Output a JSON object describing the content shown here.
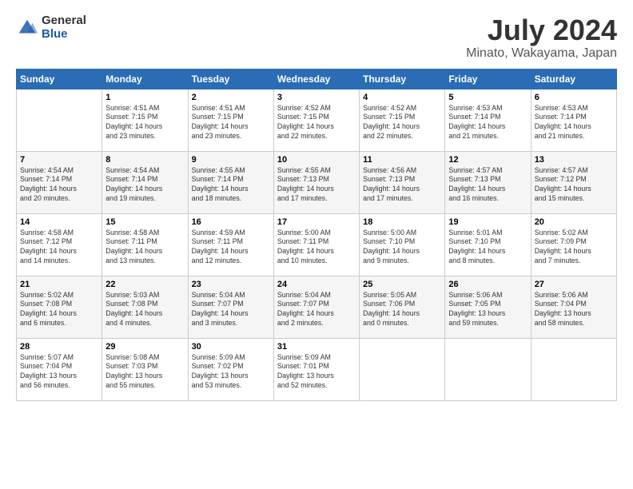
{
  "header": {
    "logo_general": "General",
    "logo_blue": "Blue",
    "month_title": "July 2024",
    "location": "Minato, Wakayama, Japan"
  },
  "days_of_week": [
    "Sunday",
    "Monday",
    "Tuesday",
    "Wednesday",
    "Thursday",
    "Friday",
    "Saturday"
  ],
  "weeks": [
    [
      {
        "day": "",
        "text": ""
      },
      {
        "day": "1",
        "text": "Sunrise: 4:51 AM\nSunset: 7:15 PM\nDaylight: 14 hours\nand 23 minutes."
      },
      {
        "day": "2",
        "text": "Sunrise: 4:51 AM\nSunset: 7:15 PM\nDaylight: 14 hours\nand 23 minutes."
      },
      {
        "day": "3",
        "text": "Sunrise: 4:52 AM\nSunset: 7:15 PM\nDaylight: 14 hours\nand 22 minutes."
      },
      {
        "day": "4",
        "text": "Sunrise: 4:52 AM\nSunset: 7:15 PM\nDaylight: 14 hours\nand 22 minutes."
      },
      {
        "day": "5",
        "text": "Sunrise: 4:53 AM\nSunset: 7:14 PM\nDaylight: 14 hours\nand 21 minutes."
      },
      {
        "day": "6",
        "text": "Sunrise: 4:53 AM\nSunset: 7:14 PM\nDaylight: 14 hours\nand 21 minutes."
      }
    ],
    [
      {
        "day": "7",
        "text": "Sunrise: 4:54 AM\nSunset: 7:14 PM\nDaylight: 14 hours\nand 20 minutes."
      },
      {
        "day": "8",
        "text": "Sunrise: 4:54 AM\nSunset: 7:14 PM\nDaylight: 14 hours\nand 19 minutes."
      },
      {
        "day": "9",
        "text": "Sunrise: 4:55 AM\nSunset: 7:14 PM\nDaylight: 14 hours\nand 18 minutes."
      },
      {
        "day": "10",
        "text": "Sunrise: 4:55 AM\nSunset: 7:13 PM\nDaylight: 14 hours\nand 17 minutes."
      },
      {
        "day": "11",
        "text": "Sunrise: 4:56 AM\nSunset: 7:13 PM\nDaylight: 14 hours\nand 17 minutes."
      },
      {
        "day": "12",
        "text": "Sunrise: 4:57 AM\nSunset: 7:13 PM\nDaylight: 14 hours\nand 16 minutes."
      },
      {
        "day": "13",
        "text": "Sunrise: 4:57 AM\nSunset: 7:12 PM\nDaylight: 14 hours\nand 15 minutes."
      }
    ],
    [
      {
        "day": "14",
        "text": "Sunrise: 4:58 AM\nSunset: 7:12 PM\nDaylight: 14 hours\nand 14 minutes."
      },
      {
        "day": "15",
        "text": "Sunrise: 4:58 AM\nSunset: 7:11 PM\nDaylight: 14 hours\nand 13 minutes."
      },
      {
        "day": "16",
        "text": "Sunrise: 4:59 AM\nSunset: 7:11 PM\nDaylight: 14 hours\nand 12 minutes."
      },
      {
        "day": "17",
        "text": "Sunrise: 5:00 AM\nSunset: 7:11 PM\nDaylight: 14 hours\nand 10 minutes."
      },
      {
        "day": "18",
        "text": "Sunrise: 5:00 AM\nSunset: 7:10 PM\nDaylight: 14 hours\nand 9 minutes."
      },
      {
        "day": "19",
        "text": "Sunrise: 5:01 AM\nSunset: 7:10 PM\nDaylight: 14 hours\nand 8 minutes."
      },
      {
        "day": "20",
        "text": "Sunrise: 5:02 AM\nSunset: 7:09 PM\nDaylight: 14 hours\nand 7 minutes."
      }
    ],
    [
      {
        "day": "21",
        "text": "Sunrise: 5:02 AM\nSunset: 7:08 PM\nDaylight: 14 hours\nand 6 minutes."
      },
      {
        "day": "22",
        "text": "Sunrise: 5:03 AM\nSunset: 7:08 PM\nDaylight: 14 hours\nand 4 minutes."
      },
      {
        "day": "23",
        "text": "Sunrise: 5:04 AM\nSunset: 7:07 PM\nDaylight: 14 hours\nand 3 minutes."
      },
      {
        "day": "24",
        "text": "Sunrise: 5:04 AM\nSunset: 7:07 PM\nDaylight: 14 hours\nand 2 minutes."
      },
      {
        "day": "25",
        "text": "Sunrise: 5:05 AM\nSunset: 7:06 PM\nDaylight: 14 hours\nand 0 minutes."
      },
      {
        "day": "26",
        "text": "Sunrise: 5:06 AM\nSunset: 7:05 PM\nDaylight: 13 hours\nand 59 minutes."
      },
      {
        "day": "27",
        "text": "Sunrise: 5:06 AM\nSunset: 7:04 PM\nDaylight: 13 hours\nand 58 minutes."
      }
    ],
    [
      {
        "day": "28",
        "text": "Sunrise: 5:07 AM\nSunset: 7:04 PM\nDaylight: 13 hours\nand 56 minutes."
      },
      {
        "day": "29",
        "text": "Sunrise: 5:08 AM\nSunset: 7:03 PM\nDaylight: 13 hours\nand 55 minutes."
      },
      {
        "day": "30",
        "text": "Sunrise: 5:09 AM\nSunset: 7:02 PM\nDaylight: 13 hours\nand 53 minutes."
      },
      {
        "day": "31",
        "text": "Sunrise: 5:09 AM\nSunset: 7:01 PM\nDaylight: 13 hours\nand 52 minutes."
      },
      {
        "day": "",
        "text": ""
      },
      {
        "day": "",
        "text": ""
      },
      {
        "day": "",
        "text": ""
      }
    ]
  ]
}
